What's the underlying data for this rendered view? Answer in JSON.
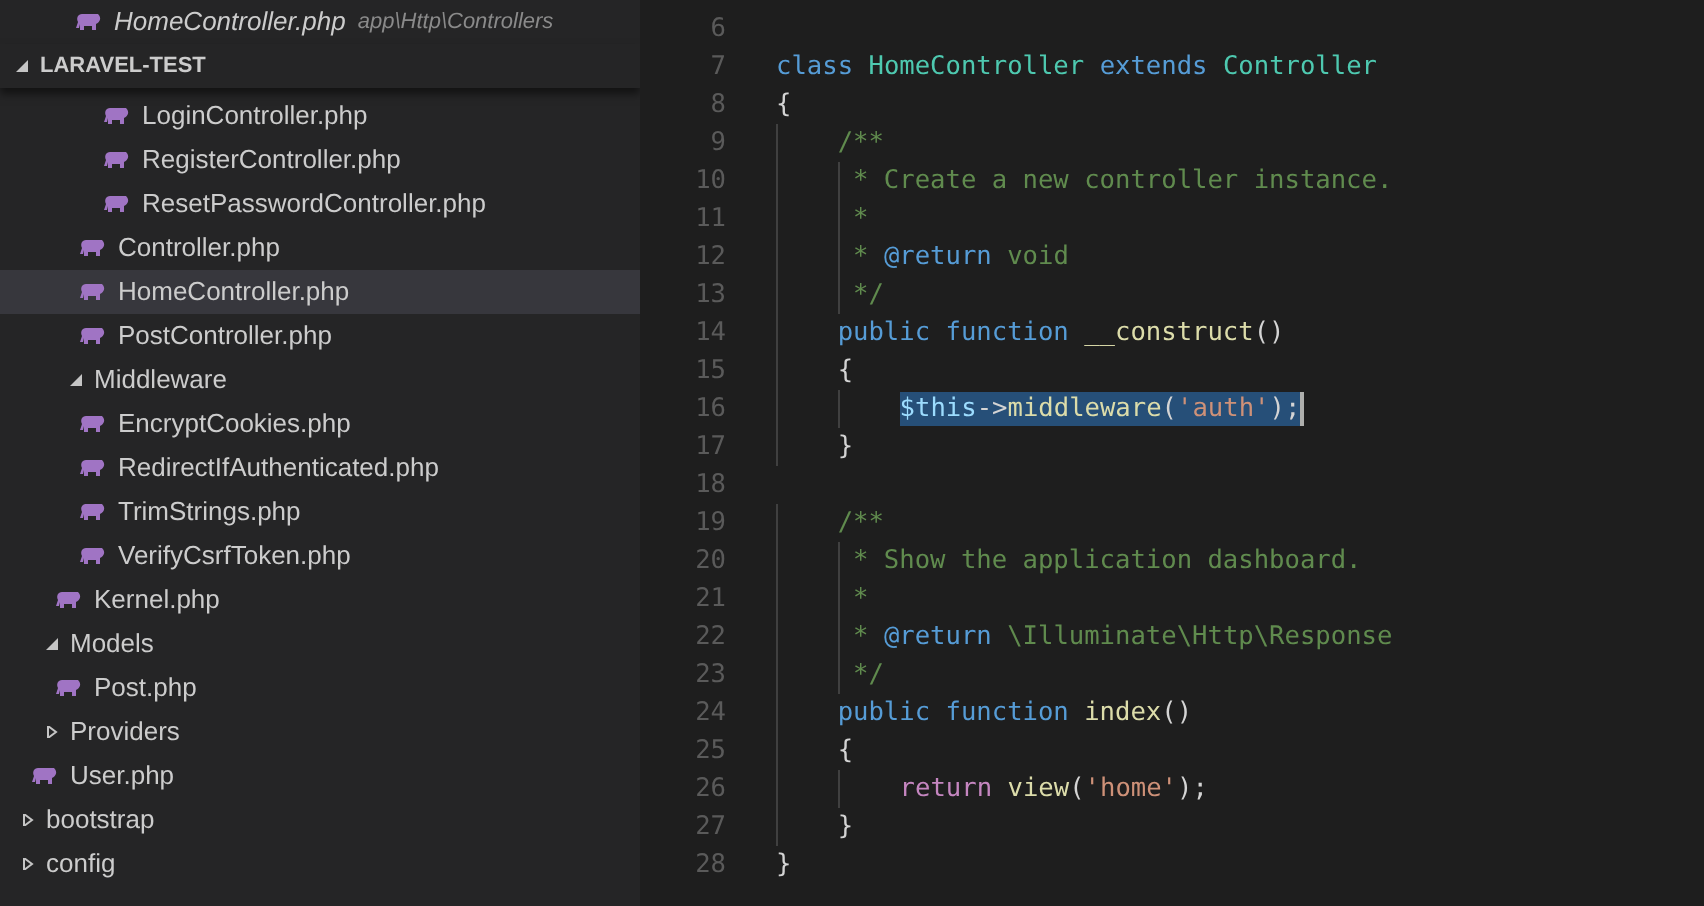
{
  "open_editors": [
    {
      "label": "HomeController.php",
      "path": "app\\Http\\Controllers"
    }
  ],
  "explorer": {
    "title": "LARAVEL-TEST",
    "expanded": true,
    "tree": [
      {
        "children": [
          {
            "children": [
              {
                "children": [
                  {
                    "children": [
                      {
                        "label": "LoginController.php",
                        "selected": false
                      },
                      {
                        "label": "RegisterController.php",
                        "selected": false
                      },
                      {
                        "label": "ResetPasswordController.php",
                        "selected": false
                      }
                    ]
                  },
                  {
                    "label": "Controller.php",
                    "selected": false
                  },
                  {
                    "label": "HomeController.php",
                    "selected": true
                  },
                  {
                    "label": "PostController.php",
                    "selected": false
                  }
                ]
              },
              {
                "label": "Middleware",
                "expanded": true,
                "selected": false,
                "children": [
                  {
                    "label": "EncryptCookies.php",
                    "selected": false
                  },
                  {
                    "label": "RedirectIfAuthenticated.php",
                    "selected": false
                  },
                  {
                    "label": "TrimStrings.php",
                    "selected": false
                  },
                  {
                    "label": "VerifyCsrfToken.php",
                    "selected": false
                  }
                ]
              },
              {
                "label": "Kernel.php",
                "selected": false
              }
            ]
          },
          {
            "label": "Models",
            "expanded": true,
            "selected": false,
            "children": [
              {
                "label": "Post.php",
                "selected": false
              }
            ]
          },
          {
            "label": "Providers",
            "expanded": false,
            "selected": false
          },
          {
            "label": "User.php",
            "selected": false
          }
        ]
      },
      {
        "label": "bootstrap",
        "expanded": false,
        "selected": false
      },
      {
        "label": "config",
        "expanded": false,
        "selected": false
      }
    ]
  },
  "editor": {
    "lines": [
      {
        "number": "6"
      },
      {
        "number": "7",
        "tokens": [
          {
            "text": "class ",
            "kind": "keyword"
          },
          {
            "text": "HomeController ",
            "kind": "class"
          },
          {
            "text": "extends ",
            "kind": "keyword"
          },
          {
            "text": "Controller",
            "kind": "class"
          }
        ]
      },
      {
        "number": "8",
        "tokens": [
          {
            "text": "{",
            "kind": "plain"
          }
        ]
      },
      {
        "number": "9",
        "tokens": [
          {
            "text": "    /**",
            "kind": "comment"
          }
        ]
      },
      {
        "number": "10",
        "tokens": [
          {
            "text": "     * Create a new controller instance.",
            "kind": "comment"
          }
        ]
      },
      {
        "number": "11",
        "tokens": [
          {
            "text": "     *",
            "kind": "comment"
          }
        ]
      },
      {
        "number": "12",
        "tokens": [
          {
            "text": "     * ",
            "kind": "comment"
          },
          {
            "text": "@return",
            "kind": "doctag"
          },
          {
            "text": " void",
            "kind": "comment"
          }
        ]
      },
      {
        "number": "13",
        "tokens": [
          {
            "text": "     */",
            "kind": "comment"
          }
        ]
      },
      {
        "number": "14",
        "tokens": [
          {
            "text": "    public ",
            "kind": "keyword"
          },
          {
            "text": "function ",
            "kind": "keyword"
          },
          {
            "text": "__construct",
            "kind": "func"
          },
          {
            "text": "()",
            "kind": "plain"
          }
        ]
      },
      {
        "number": "15",
        "tokens": [
          {
            "text": "    {",
            "kind": "plain"
          }
        ]
      },
      {
        "number": "16",
        "kind": "indented",
        "cursor": true,
        "tokens": [
          {
            "text": "$this",
            "kind": "var",
            "selected": true
          },
          {
            "text": "->",
            "kind": "plain",
            "selected": true
          },
          {
            "text": "middleware",
            "kind": "func",
            "selected": true
          },
          {
            "text": "(",
            "kind": "plain",
            "selected": true
          },
          {
            "text": "'auth'",
            "kind": "string",
            "selected": true
          },
          {
            "text": ");",
            "kind": "plain",
            "selected": true
          }
        ]
      },
      {
        "number": "17",
        "tokens": [
          {
            "text": "    }",
            "kind": "plain"
          }
        ]
      },
      {
        "number": "18"
      },
      {
        "number": "19",
        "tokens": [
          {
            "text": "    /**",
            "kind": "comment"
          }
        ]
      },
      {
        "number": "20",
        "tokens": [
          {
            "text": "     * Show the application dashboard.",
            "kind": "comment"
          }
        ]
      },
      {
        "number": "21",
        "tokens": [
          {
            "text": "     *",
            "kind": "comment"
          }
        ]
      },
      {
        "number": "22",
        "tokens": [
          {
            "text": "     * ",
            "kind": "comment"
          },
          {
            "text": "@return",
            "kind": "doctag"
          },
          {
            "text": " \\Illuminate\\Http\\Response",
            "kind": "comment"
          }
        ]
      },
      {
        "number": "23",
        "tokens": [
          {
            "text": "     */",
            "kind": "comment"
          }
        ]
      },
      {
        "number": "24",
        "tokens": [
          {
            "text": "    public ",
            "kind": "keyword"
          },
          {
            "text": "function ",
            "kind": "keyword"
          },
          {
            "text": "index",
            "kind": "func"
          },
          {
            "text": "()",
            "kind": "plain"
          }
        ]
      },
      {
        "number": "25",
        "tokens": [
          {
            "text": "    {",
            "kind": "plain"
          }
        ]
      },
      {
        "number": "26",
        "kind": "indented",
        "tokens": [
          {
            "text": "return ",
            "kind": "control"
          },
          {
            "text": "view",
            "kind": "func"
          },
          {
            "text": "(",
            "kind": "plain"
          },
          {
            "text": "'home'",
            "kind": "string"
          },
          {
            "text": ");",
            "kind": "plain"
          }
        ]
      },
      {
        "number": "27",
        "tokens": [
          {
            "text": "    }",
            "kind": "plain"
          }
        ]
      },
      {
        "number": "28",
        "tokens": [
          {
            "text": "}",
            "kind": "plain"
          }
        ]
      }
    ]
  }
}
